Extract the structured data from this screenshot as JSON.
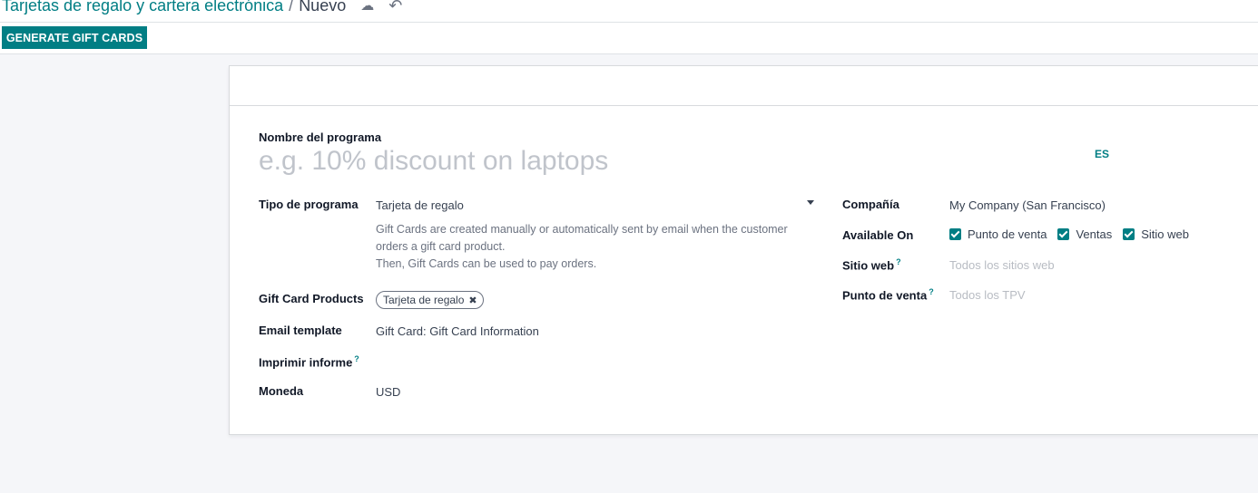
{
  "breadcrumb": {
    "parent": "Tarjetas de regalo y cartera electrónica",
    "separator": "/",
    "current": "Nuevo",
    "icons": [
      "cloud-upload-icon",
      "undo-icon"
    ]
  },
  "toolbar": {
    "generate_label": "GENERATE GIFT CARDS"
  },
  "form": {
    "program_name_label": "Nombre del programa",
    "program_name_placeholder": "e.g. 10% discount on laptops",
    "lang_badge": "ES",
    "program_type_label": "Tipo de programa",
    "program_type_value": "Tarjeta de regalo",
    "program_type_desc": [
      "Gift Cards are created manually or automatically sent by email when the customer",
      "orders a gift card product.",
      "Then, Gift Cards can be used to pay orders."
    ],
    "gift_card_products_label": "Gift Card Products",
    "gift_card_products_tag": "Tarjeta de regalo",
    "email_template_label": "Email template",
    "email_template_value": "Gift Card: Gift Card Information",
    "print_report_label": "Imprimir informe",
    "currency_label": "Moneda",
    "currency_value": "USD",
    "company_label": "Compañía",
    "company_value": "My Company (San Francisco)",
    "available_on_label": "Available On",
    "available_on_options": [
      "Punto de venta",
      "Ventas",
      "Sitio web"
    ],
    "website_label": "Sitio web",
    "website_placeholder": "Todos los sitios web",
    "pos_label": "Punto de venta",
    "pos_placeholder": "Todos los TPV",
    "help_mark": "?"
  },
  "colors": {
    "accent": "#017e84",
    "background": "#f5f6f9"
  }
}
